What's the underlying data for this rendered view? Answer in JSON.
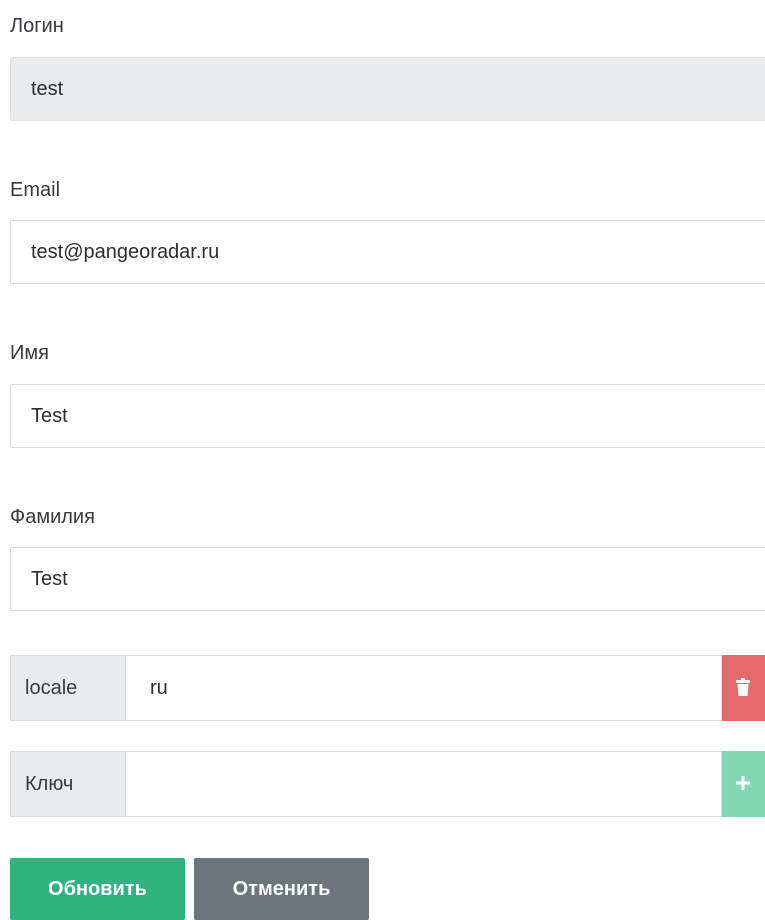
{
  "form": {
    "login": {
      "label": "Логин",
      "value": "test"
    },
    "email": {
      "label": "Email",
      "value": "test@pangeoradar.ru"
    },
    "first_name": {
      "label": "Имя",
      "value": "Test"
    },
    "last_name": {
      "label": "Фамилия",
      "value": "Test"
    }
  },
  "properties": {
    "existing": {
      "key": "locale",
      "value": "ru",
      "action_icon": "trash-icon"
    },
    "new": {
      "key_label": "Ключ",
      "value": "",
      "action_icon": "plus-icon"
    }
  },
  "actions": {
    "update_label": "Обновить",
    "cancel_label": "Отменить"
  },
  "colors": {
    "primary": "#2fb380",
    "secondary": "#6c757d",
    "danger": "#e46a6b",
    "add": "#7fd8b3"
  }
}
